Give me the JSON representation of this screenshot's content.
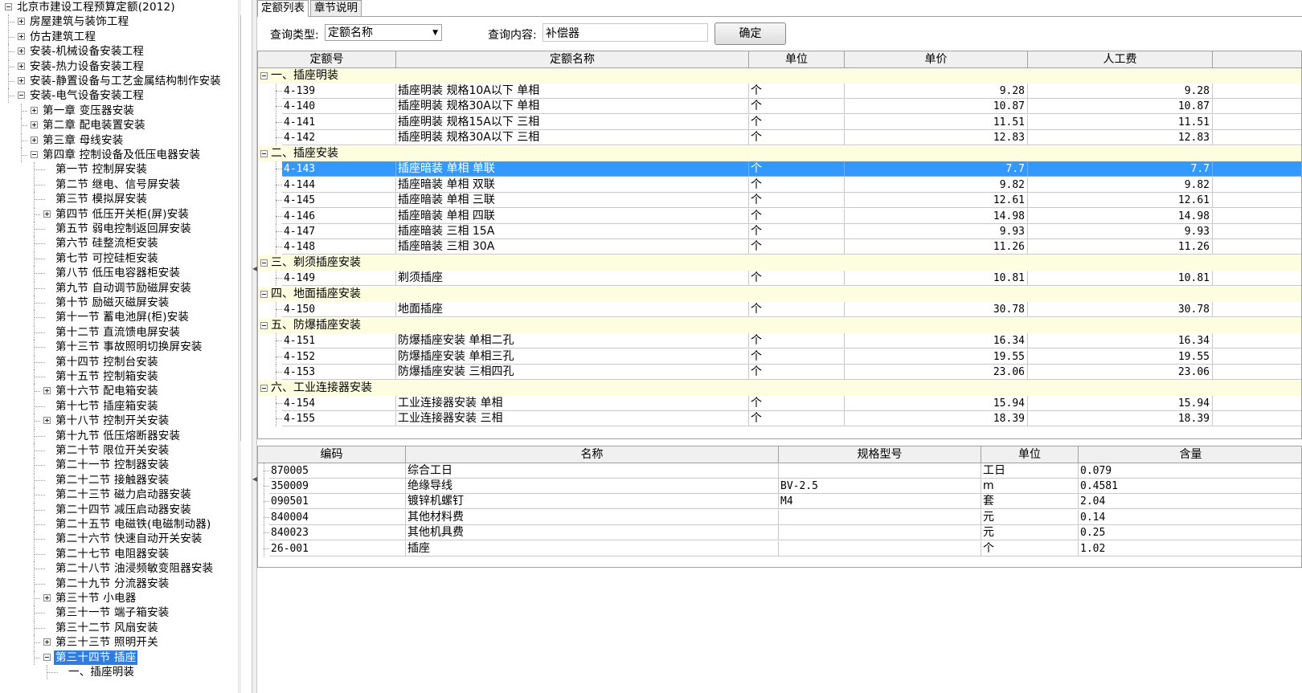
{
  "tree": {
    "root": "北京市建设工程预算定额(2012)",
    "items": [
      {
        "label": "房屋建筑与装饰工程",
        "level": 1,
        "toggle": "plus"
      },
      {
        "label": "仿古建筑工程",
        "level": 1,
        "toggle": "plus"
      },
      {
        "label": "安装-机械设备安装工程",
        "level": 1,
        "toggle": "plus"
      },
      {
        "label": "安装-热力设备安装工程",
        "level": 1,
        "toggle": "plus"
      },
      {
        "label": "安装-静置设备与工艺金属结构制作安装",
        "level": 1,
        "toggle": "plus"
      },
      {
        "label": "安装-电气设备安装工程",
        "level": 1,
        "toggle": "minus"
      },
      {
        "label": "第一章  变压器安装",
        "level": 2,
        "toggle": "plus"
      },
      {
        "label": "第二章  配电装置安装",
        "level": 2,
        "toggle": "plus"
      },
      {
        "label": "第三章  母线安装",
        "level": 2,
        "toggle": "plus"
      },
      {
        "label": "第四章  控制设备及低压电器安装",
        "level": 2,
        "toggle": "minus"
      },
      {
        "label": "第一节  控制屏安装",
        "level": 3,
        "toggle": "none"
      },
      {
        "label": "第二节  继电、信号屏安装",
        "level": 3,
        "toggle": "none"
      },
      {
        "label": "第三节  模拟屏安装",
        "level": 3,
        "toggle": "none"
      },
      {
        "label": "第四节  低压开关柜(屏)安装",
        "level": 3,
        "toggle": "plus"
      },
      {
        "label": "第五节  弱电控制返回屏安装",
        "level": 3,
        "toggle": "none"
      },
      {
        "label": "第六节  硅整流柜安装",
        "level": 3,
        "toggle": "none"
      },
      {
        "label": "第七节  可控硅柜安装",
        "level": 3,
        "toggle": "none"
      },
      {
        "label": "第八节  低压电容器柜安装",
        "level": 3,
        "toggle": "none"
      },
      {
        "label": "第九节  自动调节励磁屏安装",
        "level": 3,
        "toggle": "none"
      },
      {
        "label": "第十节  励磁灭磁屏安装",
        "level": 3,
        "toggle": "none"
      },
      {
        "label": "第十一节  蓄电池屏(柜)安装",
        "level": 3,
        "toggle": "none"
      },
      {
        "label": "第十二节  直流馈电屏安装",
        "level": 3,
        "toggle": "none"
      },
      {
        "label": "第十三节  事故照明切换屏安装",
        "level": 3,
        "toggle": "none"
      },
      {
        "label": "第十四节  控制台安装",
        "level": 3,
        "toggle": "none"
      },
      {
        "label": "第十五节  控制箱安装",
        "level": 3,
        "toggle": "none"
      },
      {
        "label": "第十六节  配电箱安装",
        "level": 3,
        "toggle": "plus"
      },
      {
        "label": "第十七节  插座箱安装",
        "level": 3,
        "toggle": "none"
      },
      {
        "label": "第十八节  控制开关安装",
        "level": 3,
        "toggle": "plus"
      },
      {
        "label": "第十九节  低压熔断器安装",
        "level": 3,
        "toggle": "none"
      },
      {
        "label": "第二十节  限位开关安装",
        "level": 3,
        "toggle": "none"
      },
      {
        "label": "第二十一节  控制器安装",
        "level": 3,
        "toggle": "none"
      },
      {
        "label": "第二十二节  接触器安装",
        "level": 3,
        "toggle": "none"
      },
      {
        "label": "第二十三节  磁力启动器安装",
        "level": 3,
        "toggle": "none"
      },
      {
        "label": "第二十四节  减压启动器安装",
        "level": 3,
        "toggle": "none"
      },
      {
        "label": "第二十五节  电磁铁(电磁制动器)",
        "level": 3,
        "toggle": "none"
      },
      {
        "label": "第二十六节  快速自动开关安装",
        "level": 3,
        "toggle": "none"
      },
      {
        "label": "第二十七节  电阻器安装",
        "level": 3,
        "toggle": "none"
      },
      {
        "label": "第二十八节  油浸频敏变阻器安装",
        "level": 3,
        "toggle": "none"
      },
      {
        "label": "第二十九节  分流器安装",
        "level": 3,
        "toggle": "none"
      },
      {
        "label": "第三十节  小电器",
        "level": 3,
        "toggle": "plus"
      },
      {
        "label": "第三十一节  端子箱安装",
        "level": 3,
        "toggle": "none"
      },
      {
        "label": "第三十二节  风扇安装",
        "level": 3,
        "toggle": "none"
      },
      {
        "label": "第三十三节  照明开关",
        "level": 3,
        "toggle": "plus"
      },
      {
        "label": "第三十四节  插座",
        "level": 3,
        "toggle": "minus",
        "selected": true
      },
      {
        "label": "一、插座明装",
        "level": 4,
        "toggle": "none"
      }
    ]
  },
  "tabs": [
    {
      "label": "定额列表",
      "active": true
    },
    {
      "label": "章节说明",
      "active": false
    }
  ],
  "query": {
    "type_label": "查询类型:",
    "type_value": "定额名称",
    "content_label": "查询内容:",
    "content_value": "补偿器",
    "confirm_label": "确定"
  },
  "quota_table": {
    "headers": [
      "定额号",
      "定额名称",
      "单位",
      "单价",
      "人工费"
    ],
    "groups": [
      {
        "title": "一、插座明装",
        "rows": [
          {
            "code": "4-139",
            "name": "插座明装 规格10A以下 单相",
            "unit": "个",
            "price": "9.28",
            "labor": "9.28"
          },
          {
            "code": "4-140",
            "name": "插座明装 规格30A以下 单相",
            "unit": "个",
            "price": "10.87",
            "labor": "10.87"
          },
          {
            "code": "4-141",
            "name": "插座明装 规格15A以下 三相",
            "unit": "个",
            "price": "11.51",
            "labor": "11.51"
          },
          {
            "code": "4-142",
            "name": "插座明装 规格30A以下 三相",
            "unit": "个",
            "price": "12.83",
            "labor": "12.83"
          }
        ]
      },
      {
        "title": "二、插座安装",
        "rows": [
          {
            "code": "4-143",
            "name": "插座暗装 单相 单联",
            "unit": "个",
            "price": "7.7",
            "labor": "7.7",
            "selected": true
          },
          {
            "code": "4-144",
            "name": "插座暗装 单相 双联",
            "unit": "个",
            "price": "9.82",
            "labor": "9.82"
          },
          {
            "code": "4-145",
            "name": "插座暗装 单相 三联",
            "unit": "个",
            "price": "12.61",
            "labor": "12.61"
          },
          {
            "code": "4-146",
            "name": "插座暗装 单相 四联",
            "unit": "个",
            "price": "14.98",
            "labor": "14.98"
          },
          {
            "code": "4-147",
            "name": "插座暗装 三相 15A",
            "unit": "个",
            "price": "9.93",
            "labor": "9.93"
          },
          {
            "code": "4-148",
            "name": "插座暗装 三相 30A",
            "unit": "个",
            "price": "11.26",
            "labor": "11.26"
          }
        ]
      },
      {
        "title": "三、剃须插座安装",
        "rows": [
          {
            "code": "4-149",
            "name": "剃须插座",
            "unit": "个",
            "price": "10.81",
            "labor": "10.81"
          }
        ]
      },
      {
        "title": "四、地面插座安装",
        "rows": [
          {
            "code": "4-150",
            "name": "地面插座",
            "unit": "个",
            "price": "30.78",
            "labor": "30.78"
          }
        ]
      },
      {
        "title": "五、防爆插座安装",
        "rows": [
          {
            "code": "4-151",
            "name": "防爆插座安装 单相二孔",
            "unit": "个",
            "price": "16.34",
            "labor": "16.34"
          },
          {
            "code": "4-152",
            "name": "防爆插座安装 单相三孔",
            "unit": "个",
            "price": "19.55",
            "labor": "19.55"
          },
          {
            "code": "4-153",
            "name": "防爆插座安装 三相四孔",
            "unit": "个",
            "price": "23.06",
            "labor": "23.06"
          }
        ]
      },
      {
        "title": "六、工业连接器安装",
        "rows": [
          {
            "code": "4-154",
            "name": "工业连接器安装 单相",
            "unit": "个",
            "price": "15.94",
            "labor": "15.94"
          },
          {
            "code": "4-155",
            "name": "工业连接器安装 三相",
            "unit": "个",
            "price": "18.39",
            "labor": "18.39"
          }
        ]
      }
    ]
  },
  "material_table": {
    "headers": [
      "编码",
      "名称",
      "规格型号",
      "单位",
      "含量"
    ],
    "rows": [
      {
        "code": "870005",
        "name": "综合工日",
        "spec": "",
        "unit": "工日",
        "qty": "0.079"
      },
      {
        "code": "350009",
        "name": "绝缘导线",
        "spec": "BV-2.5",
        "unit": "m",
        "qty": "0.4581"
      },
      {
        "code": "090501",
        "name": "镀锌机螺钉",
        "spec": "M4",
        "unit": "套",
        "qty": "2.04"
      },
      {
        "code": "840004",
        "name": "其他材料费",
        "spec": "",
        "unit": "元",
        "qty": "0.14"
      },
      {
        "code": "840023",
        "name": "其他机具费",
        "spec": "",
        "unit": "元",
        "qty": "0.25"
      },
      {
        "code": "26-001",
        "name": "插座",
        "spec": "",
        "unit": "个",
        "qty": "1.02"
      }
    ]
  },
  "colors": {
    "selection": "#3399ff",
    "tree_selection": "#2f7de0",
    "group_row_bg": "#fdfde0"
  }
}
